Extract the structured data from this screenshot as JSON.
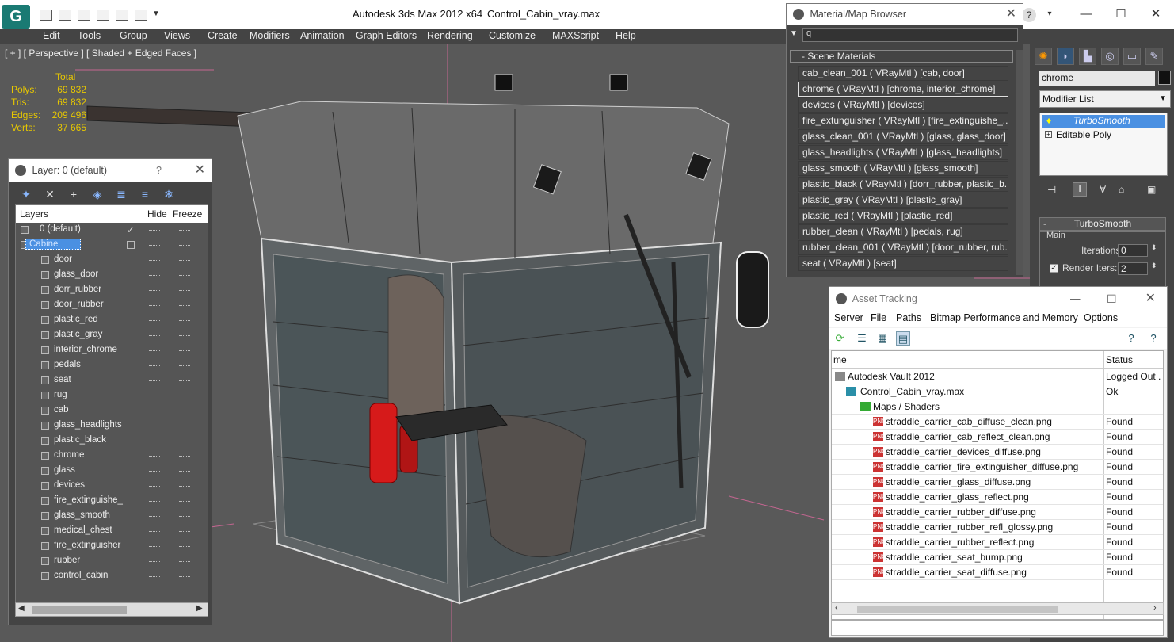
{
  "app": {
    "title": "Autodesk 3ds Max  2012 x64",
    "file": "Control_Cabin_vray.max",
    "logo": "G"
  },
  "menu": [
    "Edit",
    "Tools",
    "Group",
    "Views",
    "Create",
    "Modifiers",
    "Animation",
    "Graph Editors",
    "Rendering",
    "Customize",
    "MAXScript",
    "Help"
  ],
  "viewport": {
    "label": "[ + ] [ Perspective ] [ Shaded + Edged Faces ]",
    "stats": {
      "header": "Total",
      "rows": [
        {
          "k": "Polys:",
          "v": "69 832"
        },
        {
          "k": "Tris:",
          "v": "69 832"
        },
        {
          "k": "Edges:",
          "v": "209 496"
        },
        {
          "k": "Verts:",
          "v": "37 665"
        }
      ]
    }
  },
  "layer_panel": {
    "title": "Layer: 0 (default)",
    "help": "?",
    "close": "✕",
    "columns": {
      "layers": "Layers",
      "hide": "Hide",
      "freeze": "Freeze"
    },
    "default_layer": "0 (default)",
    "cabine": "Cabine",
    "items": [
      "door",
      "glass_door",
      "dorr_rubber",
      "door_rubber",
      "plastic_red",
      "plastic_gray",
      "interior_chrome",
      "pedals",
      "seat",
      "rug",
      "cab",
      "glass_headlights",
      "plastic_black",
      "chrome",
      "glass",
      "devices",
      "fire_extinguishe_",
      "glass_smooth",
      "medical_chest",
      "fire_extinguisher",
      "rubber",
      "control_cabin"
    ],
    "tool_icons": [
      "new-layer-icon",
      "delete-icon",
      "add-icon",
      "select-icon",
      "highlight-icon",
      "hide-all-icon",
      "freeze-all-icon"
    ]
  },
  "material_browser": {
    "title": "Material/Map Browser",
    "close": "✕",
    "search_value": "q",
    "section": "- Scene Materials",
    "materials": [
      "cab_clean_001  ( VRayMtl ) [cab, door]",
      "chrome  ( VRayMtl ) [chrome, interior_chrome]",
      "devices  ( VRayMtl ) [devices]",
      "fire_extunguisher  ( VRayMtl ) [fire_extinguishe_...",
      "glass_clean_001  ( VRayMtl ) [glass, glass_door]",
      "glass_headlights  ( VRayMtl ) [glass_headlights]",
      "glass_smooth  ( VRayMtl ) [glass_smooth]",
      "plastic_black  ( VRayMtl ) [dorr_rubber, plastic_b...",
      "plastic_gray  ( VRayMtl ) [plastic_gray]",
      "plastic_red  ( VRayMtl ) [plastic_red]",
      "rubber_clean  ( VRayMtl ) [pedals, rug]",
      "rubber_clean_001  ( VRayMtl ) [door_rubber, rub...",
      "seat  ( VRayMtl ) [seat]"
    ],
    "selected_index": 1
  },
  "command_panel": {
    "object_name": "chrome",
    "modifier_list": "Modifier List",
    "stack": [
      "TurboSmooth",
      "Editable Poly"
    ],
    "rollout_title": "TurboSmooth",
    "group_main": "Main",
    "iterations_label": "Iterations:",
    "iterations_value": "0",
    "render_iters_label": "Render Iters:",
    "render_iters_value": "2"
  },
  "asset_tracking": {
    "title": "Asset Tracking",
    "menu": [
      "Server",
      "File",
      "Paths",
      "Bitmap Performance and Memory",
      "Options"
    ],
    "columns": {
      "name": "me",
      "status": "Status"
    },
    "vault": {
      "name": "Autodesk Vault 2012",
      "status": "Logged Out ."
    },
    "file": {
      "name": "Control_Cabin_vray.max",
      "status": "Ok"
    },
    "folder": "Maps / Shaders",
    "icon_text": "PNG",
    "files": [
      {
        "name": "straddle_carrier_cab_diffuse_clean.png",
        "status": "Found"
      },
      {
        "name": "straddle_carrier_cab_reflect_clean.png",
        "status": "Found"
      },
      {
        "name": "straddle_carrier_devices_diffuse.png",
        "status": "Found"
      },
      {
        "name": "straddle_carrier_fire_extinguisher_diffuse.png",
        "status": "Found"
      },
      {
        "name": "straddle_carrier_glass_diffuse.png",
        "status": "Found"
      },
      {
        "name": "straddle_carrier_glass_reflect.png",
        "status": "Found"
      },
      {
        "name": "straddle_carrier_rubber_diffuse.png",
        "status": "Found"
      },
      {
        "name": "straddle_carrier_rubber_refl_glossy.png",
        "status": "Found"
      },
      {
        "name": "straddle_carrier_rubber_reflect.png",
        "status": "Found"
      },
      {
        "name": "straddle_carrier_seat_bump.png",
        "status": "Found"
      },
      {
        "name": "straddle_carrier_seat_diffuse.png",
        "status": "Found"
      }
    ]
  },
  "colors": {
    "stats_yellow": "#e8c800",
    "selection_blue": "#4a90e2",
    "viewport_bg": "#595959",
    "extinguisher_red": "#d61a1a"
  }
}
